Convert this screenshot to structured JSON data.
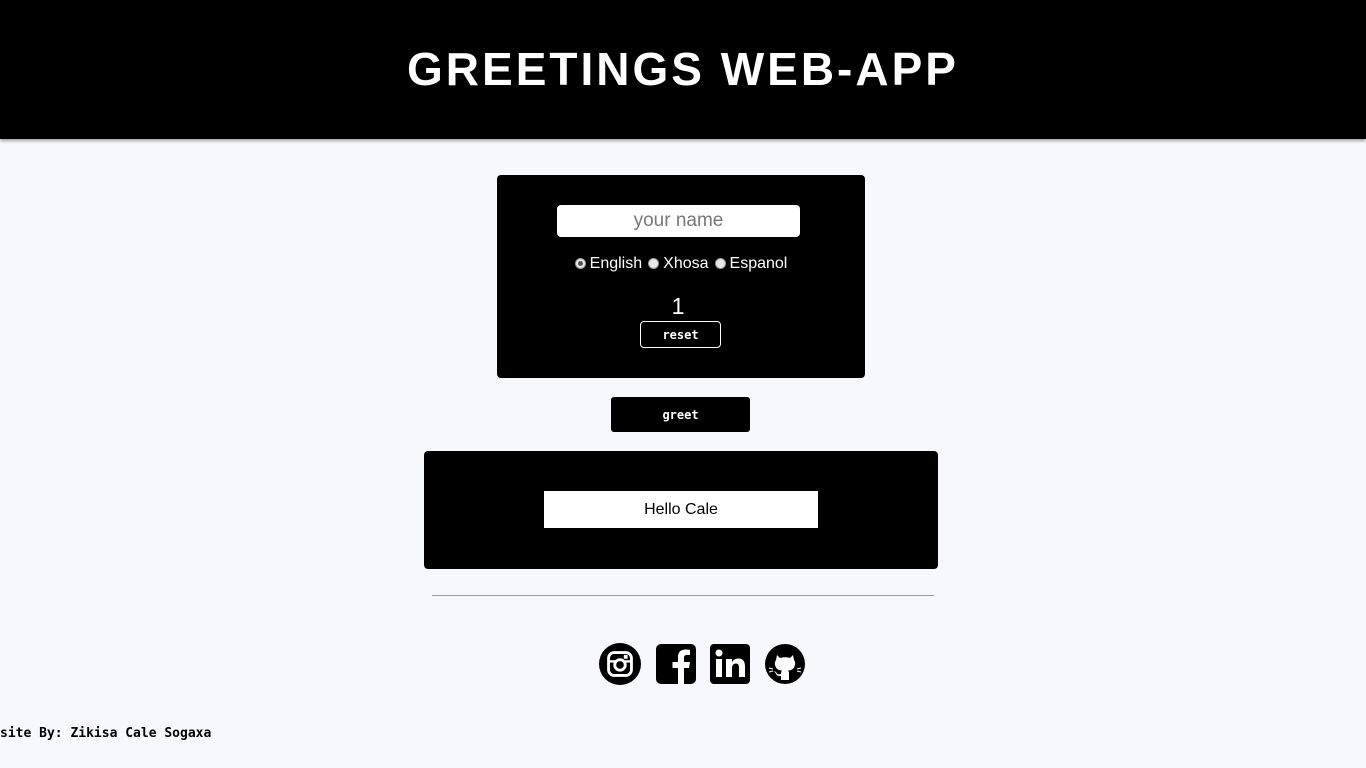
{
  "header": {
    "title": "GREETINGS WEB-APP"
  },
  "form": {
    "name_placeholder": "your name",
    "name_value": "",
    "languages": [
      {
        "label": "English",
        "selected": true
      },
      {
        "label": "Xhosa",
        "selected": false
      },
      {
        "label": "Espanol",
        "selected": false
      }
    ],
    "counter": "1",
    "reset_label": "reset"
  },
  "greet_label": "greet",
  "output": {
    "message": "Hello Cale"
  },
  "social": {
    "icons": [
      "instagram-icon",
      "facebook-icon",
      "linkedin-icon",
      "github-icon"
    ]
  },
  "footer": {
    "credit": "site By: Zikisa Cale Sogaxa"
  },
  "colors": {
    "background": "#f7f8fd",
    "panel": "#000000",
    "text_light": "#ffffff"
  }
}
